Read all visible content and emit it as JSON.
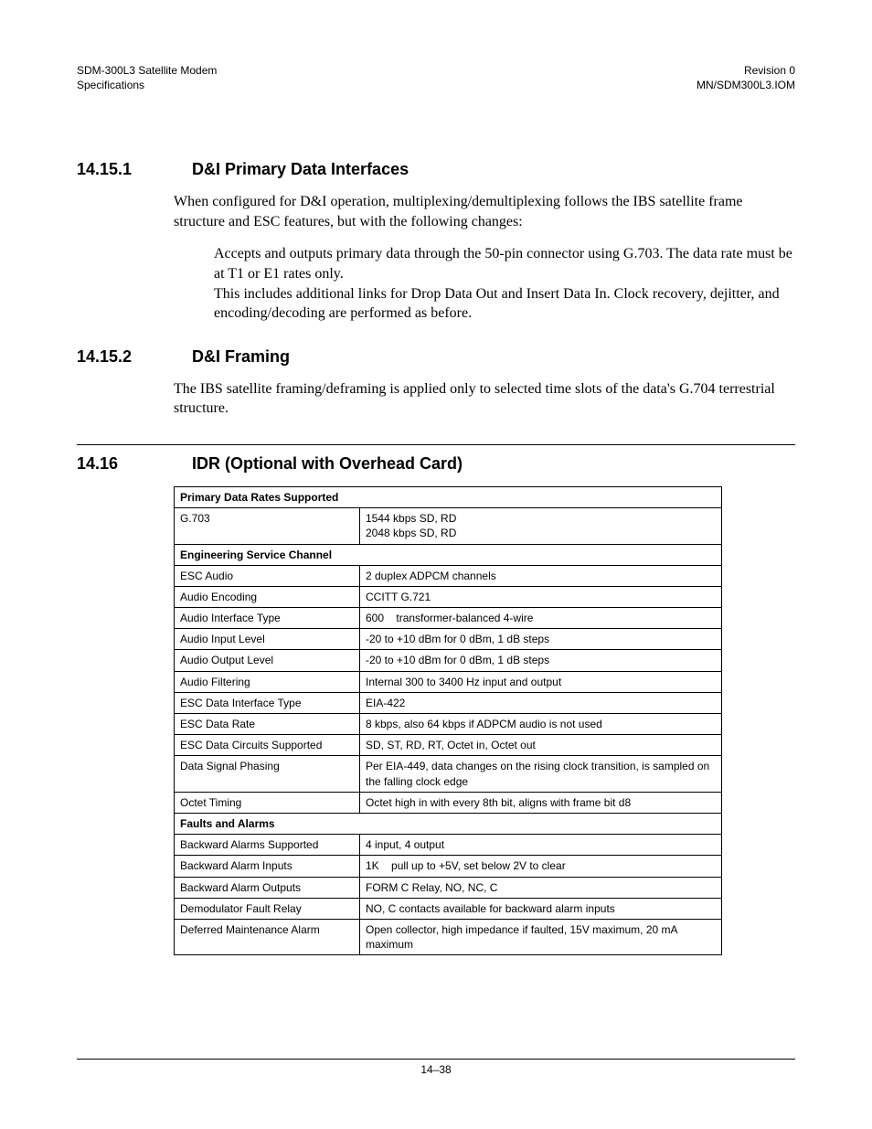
{
  "header": {
    "left1": "SDM-300L3 Satellite Modem",
    "left2": "Specifications",
    "right1": "Revision 0",
    "right2": "MN/SDM300L3.IOM"
  },
  "sections": {
    "s1": {
      "num": "14.15.1",
      "title": "D&I Primary Data Interfaces",
      "para1": "When configured for D&I operation, multiplexing/demultiplexing follows the IBS satellite frame structure and ESC features, but with the following changes:",
      "sub1": "Accepts and outputs primary data through the 50-pin connector using G.703. The data rate must be at T1 or E1 rates only.",
      "sub2": "This includes additional links for Drop Data Out and Insert Data In. Clock recovery, dejitter, and encoding/decoding are performed as before."
    },
    "s2": {
      "num": "14.15.2",
      "title": "D&I Framing",
      "para1": "The IBS satellite framing/deframing is applied only to selected time slots of the data's G.704 terrestrial structure."
    },
    "s3": {
      "num": "14.16",
      "title": "IDR (Optional with Overhead Card)"
    }
  },
  "table": {
    "group1_header": "Primary Data Rates Supported",
    "r1_label": "G.703",
    "r1_val_line1": "1544 kbps SD, RD",
    "r1_val_line2": "2048 kbps SD, RD",
    "group2_header": "Engineering Service Channel",
    "r2_label": "ESC Audio",
    "r2_val": "2 duplex ADPCM channels",
    "r3_label": "Audio Encoding",
    "r3_val": "CCITT G.721",
    "r4_label": "Audio Interface Type",
    "r4_val": "600    transformer-balanced 4-wire",
    "r5_label": "Audio Input Level",
    "r5_val": "-20 to +10 dBm for 0 dBm, 1 dB steps",
    "r6_label": "Audio Output Level",
    "r6_val": "-20 to +10 dBm for 0 dBm, 1 dB steps",
    "r7_label": "Audio Filtering",
    "r7_val": "Internal 300 to 3400 Hz input and output",
    "r8_label": "ESC Data Interface Type",
    "r8_val": "EIA-422",
    "r9_label": "ESC Data Rate",
    "r9_val": "8 kbps, also 64 kbps if ADPCM audio is not used",
    "r10_label": "ESC Data Circuits Supported",
    "r10_val": "SD, ST, RD, RT, Octet in, Octet out",
    "r11_label": "Data Signal Phasing",
    "r11_val": "Per EIA-449, data changes on the rising clock transition, is sampled on the falling clock edge",
    "r12_label": "Octet Timing",
    "r12_val": "Octet high in with every 8th bit, aligns with frame bit d8",
    "group3_header": "Faults and Alarms",
    "r13_label": "Backward Alarms Supported",
    "r13_val": "4 input, 4 output",
    "r14_label": "Backward Alarm Inputs",
    "r14_val": "1K    pull up to +5V, set below 2V to clear",
    "r15_label": "Backward Alarm Outputs",
    "r15_val": "FORM C Relay, NO, NC, C",
    "r16_label": "Demodulator Fault Relay",
    "r16_val": "NO, C contacts available for backward alarm inputs",
    "r17_label": "Deferred Maintenance Alarm",
    "r17_val": "Open collector, high impedance if faulted, 15V maximum, 20 mA maximum"
  },
  "footer": {
    "page_num": "14–38"
  }
}
